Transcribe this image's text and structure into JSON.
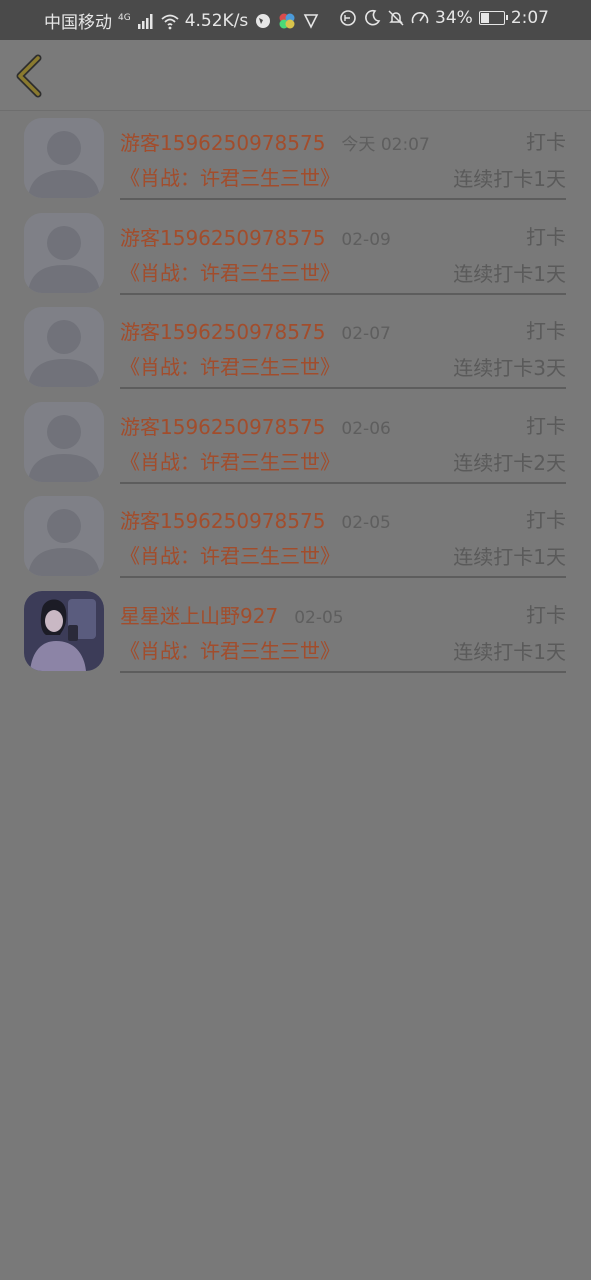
{
  "status_bar": {
    "carrier": "中国移动",
    "network": "4G",
    "speed": "4.52K/s",
    "battery": "34%",
    "battery_level": 0.34,
    "time": "2:07"
  },
  "app_bar": {
    "back_icon": "chevron-left-icon",
    "accent": "#8a7a2e"
  },
  "records": [
    {
      "name": "游客1596250978575",
      "time": "今天 02:07",
      "book": "《肖战：许君三生三世》",
      "action": "打卡",
      "streak": "连续打卡1天",
      "avatar": "default"
    },
    {
      "name": "游客1596250978575",
      "time": "02-09",
      "book": "《肖战：许君三生三世》",
      "action": "打卡",
      "streak": "连续打卡1天",
      "avatar": "default"
    },
    {
      "name": "游客1596250978575",
      "time": "02-07",
      "book": "《肖战：许君三生三世》",
      "action": "打卡",
      "streak": "连续打卡3天",
      "avatar": "default"
    },
    {
      "name": "游客1596250978575",
      "time": "02-06",
      "book": "《肖战：许君三生三世》",
      "action": "打卡",
      "streak": "连续打卡2天",
      "avatar": "default"
    },
    {
      "name": "游客1596250978575",
      "time": "02-05",
      "book": "《肖战：许君三生三世》",
      "action": "打卡",
      "streak": "连续打卡1天",
      "avatar": "default"
    },
    {
      "name": "星星迷上山野927",
      "time": "02-05",
      "book": "《肖战：许君三生三世》",
      "action": "打卡",
      "streak": "连续打卡1天",
      "avatar": "photo"
    }
  ],
  "colors": {
    "name_text": "#a24d2c",
    "secondary_text": "#5a5a5a",
    "background": "#797979"
  }
}
